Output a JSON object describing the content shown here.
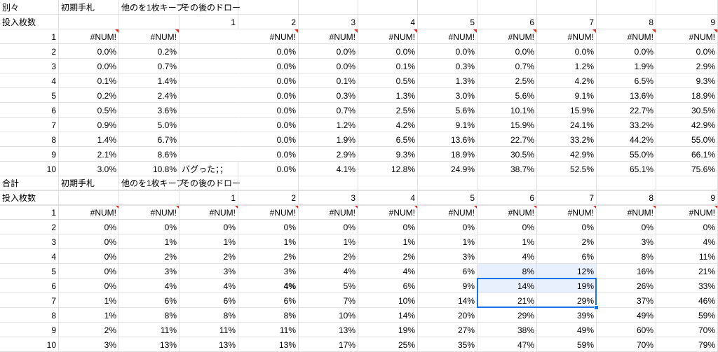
{
  "sections": [
    {
      "labels": {
        "a": "別々",
        "b": "初期手札",
        "c": "他のを1枚キープ",
        "d": "その後のドロー"
      },
      "count_label": "投入枚数",
      "draw_headers": [
        "1",
        "2",
        "3",
        "4",
        "5",
        "6",
        "7",
        "8",
        "9"
      ],
      "note": "バグった；；",
      "rows": [
        {
          "n": "1",
          "b": "#NUM!",
          "c": "#NUM!",
          "d": [
            "",
            "#NUM!",
            "#NUM!",
            "#NUM!",
            "#NUM!",
            "#NUM!",
            "#NUM!",
            "#NUM!",
            "#NUM!"
          ]
        },
        {
          "n": "2",
          "b": "0.0%",
          "c": "0.2%",
          "d": [
            "",
            "0.0%",
            "0.0%",
            "0.0%",
            "0.0%",
            "0.0%",
            "0.0%",
            "0.0%",
            "0.0%"
          ]
        },
        {
          "n": "3",
          "b": "0.0%",
          "c": "0.7%",
          "d": [
            "",
            "0.0%",
            "0.0%",
            "0.1%",
            "0.3%",
            "0.7%",
            "1.2%",
            "1.9%",
            "2.9%"
          ]
        },
        {
          "n": "4",
          "b": "0.1%",
          "c": "1.4%",
          "d": [
            "",
            "0.0%",
            "0.1%",
            "0.5%",
            "1.3%",
            "2.5%",
            "4.2%",
            "6.5%",
            "9.3%"
          ]
        },
        {
          "n": "5",
          "b": "0.2%",
          "c": "2.4%",
          "d": [
            "",
            "0.0%",
            "0.3%",
            "1.3%",
            "3.0%",
            "5.6%",
            "9.1%",
            "13.6%",
            "18.9%"
          ]
        },
        {
          "n": "6",
          "b": "0.5%",
          "c": "3.6%",
          "d": [
            "",
            "0.0%",
            "0.7%",
            "2.5%",
            "5.6%",
            "10.1%",
            "15.9%",
            "22.7%",
            "30.5%"
          ]
        },
        {
          "n": "7",
          "b": "0.9%",
          "c": "5.0%",
          "d": [
            "",
            "0.0%",
            "1.2%",
            "4.2%",
            "9.1%",
            "15.9%",
            "24.1%",
            "33.2%",
            "42.9%"
          ]
        },
        {
          "n": "8",
          "b": "1.4%",
          "c": "6.7%",
          "d": [
            "",
            "0.0%",
            "1.9%",
            "6.5%",
            "13.6%",
            "22.7%",
            "33.2%",
            "44.2%",
            "55.0%"
          ]
        },
        {
          "n": "9",
          "b": "2.1%",
          "c": "8.6%",
          "d": [
            "",
            "0.0%",
            "2.9%",
            "9.3%",
            "18.9%",
            "30.5%",
            "42.9%",
            "55.0%",
            "66.1%"
          ]
        },
        {
          "n": "10",
          "b": "3.0%",
          "c": "10.8%",
          "d": [
            "バグった；；",
            "0.0%",
            "4.1%",
            "12.8%",
            "24.9%",
            "38.7%",
            "52.5%",
            "65.1%",
            "75.6%"
          ]
        }
      ]
    },
    {
      "labels": {
        "a": "合計",
        "b": "初期手札",
        "c": "他のを1枚キープ",
        "d": "その後のドロー"
      },
      "count_label": "投入枚数",
      "draw_headers": [
        "1",
        "2",
        "3",
        "4",
        "5",
        "6",
        "7",
        "8",
        "9"
      ],
      "rows": [
        {
          "n": "1",
          "b": "#NUM!",
          "c": "#NUM!",
          "d": [
            "#NUM!",
            "#NUM!",
            "#NUM!",
            "#NUM!",
            "#NUM!",
            "#NUM!",
            "#NUM!",
            "#NUM!",
            "#NUM!"
          ]
        },
        {
          "n": "2",
          "b": "0%",
          "c": "0%",
          "d": [
            "0%",
            "0%",
            "0%",
            "0%",
            "0%",
            "0%",
            "0%",
            "0%",
            "0%"
          ]
        },
        {
          "n": "3",
          "b": "0%",
          "c": "1%",
          "d": [
            "1%",
            "1%",
            "1%",
            "1%",
            "1%",
            "1%",
            "2%",
            "3%",
            "4%"
          ]
        },
        {
          "n": "4",
          "b": "0%",
          "c": "2%",
          "d": [
            "2%",
            "2%",
            "2%",
            "2%",
            "3%",
            "4%",
            "6%",
            "8%",
            "11%"
          ]
        },
        {
          "n": "5",
          "b": "0%",
          "c": "3%",
          "d": [
            "3%",
            "3%",
            "4%",
            "4%",
            "6%",
            "8%",
            "12%",
            "16%",
            "21%"
          ]
        },
        {
          "n": "6",
          "b": "0%",
          "c": "4%",
          "d": [
            "4%",
            "4%",
            "5%",
            "6%",
            "9%",
            "14%",
            "19%",
            "26%",
            "33%"
          ]
        },
        {
          "n": "7",
          "b": "1%",
          "c": "6%",
          "d": [
            "6%",
            "6%",
            "7%",
            "10%",
            "14%",
            "21%",
            "29%",
            "37%",
            "46%"
          ]
        },
        {
          "n": "8",
          "b": "1%",
          "c": "8%",
          "d": [
            "8%",
            "8%",
            "10%",
            "14%",
            "20%",
            "29%",
            "39%",
            "49%",
            "59%"
          ]
        },
        {
          "n": "9",
          "b": "2%",
          "c": "11%",
          "d": [
            "11%",
            "11%",
            "13%",
            "19%",
            "27%",
            "38%",
            "49%",
            "60%",
            "70%"
          ]
        },
        {
          "n": "10",
          "b": "3%",
          "c": "13%",
          "d": [
            "13%",
            "13%",
            "17%",
            "25%",
            "35%",
            "47%",
            "59%",
            "70%",
            "79%"
          ]
        }
      ]
    }
  ]
}
